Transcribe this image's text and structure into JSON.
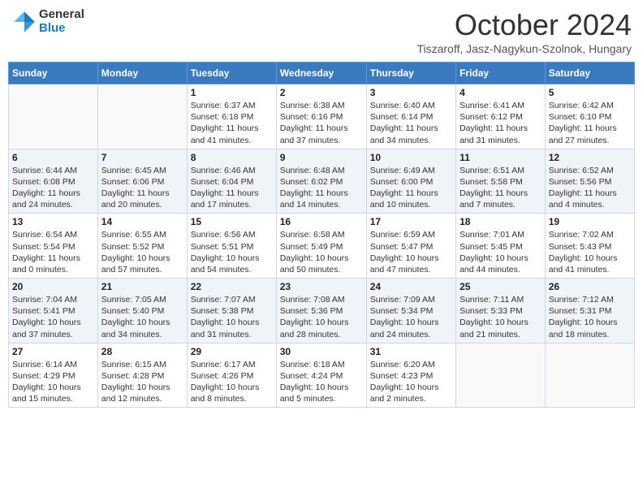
{
  "header": {
    "logo_general": "General",
    "logo_blue": "Blue",
    "month_title": "October 2024",
    "subtitle": "Tiszaroff, Jasz-Nagykun-Szolnok, Hungary"
  },
  "weekdays": [
    "Sunday",
    "Monday",
    "Tuesday",
    "Wednesday",
    "Thursday",
    "Friday",
    "Saturday"
  ],
  "weeks": [
    [
      {
        "day": "",
        "info": ""
      },
      {
        "day": "",
        "info": ""
      },
      {
        "day": "1",
        "info": "Sunrise: 6:37 AM\nSunset: 6:18 PM\nDaylight: 11 hours and 41 minutes."
      },
      {
        "day": "2",
        "info": "Sunrise: 6:38 AM\nSunset: 6:16 PM\nDaylight: 11 hours and 37 minutes."
      },
      {
        "day": "3",
        "info": "Sunrise: 6:40 AM\nSunset: 6:14 PM\nDaylight: 11 hours and 34 minutes."
      },
      {
        "day": "4",
        "info": "Sunrise: 6:41 AM\nSunset: 6:12 PM\nDaylight: 11 hours and 31 minutes."
      },
      {
        "day": "5",
        "info": "Sunrise: 6:42 AM\nSunset: 6:10 PM\nDaylight: 11 hours and 27 minutes."
      }
    ],
    [
      {
        "day": "6",
        "info": "Sunrise: 6:44 AM\nSunset: 6:08 PM\nDaylight: 11 hours and 24 minutes."
      },
      {
        "day": "7",
        "info": "Sunrise: 6:45 AM\nSunset: 6:06 PM\nDaylight: 11 hours and 20 minutes."
      },
      {
        "day": "8",
        "info": "Sunrise: 6:46 AM\nSunset: 6:04 PM\nDaylight: 11 hours and 17 minutes."
      },
      {
        "day": "9",
        "info": "Sunrise: 6:48 AM\nSunset: 6:02 PM\nDaylight: 11 hours and 14 minutes."
      },
      {
        "day": "10",
        "info": "Sunrise: 6:49 AM\nSunset: 6:00 PM\nDaylight: 11 hours and 10 minutes."
      },
      {
        "day": "11",
        "info": "Sunrise: 6:51 AM\nSunset: 5:58 PM\nDaylight: 11 hours and 7 minutes."
      },
      {
        "day": "12",
        "info": "Sunrise: 6:52 AM\nSunset: 5:56 PM\nDaylight: 11 hours and 4 minutes."
      }
    ],
    [
      {
        "day": "13",
        "info": "Sunrise: 6:54 AM\nSunset: 5:54 PM\nDaylight: 11 hours and 0 minutes."
      },
      {
        "day": "14",
        "info": "Sunrise: 6:55 AM\nSunset: 5:52 PM\nDaylight: 10 hours and 57 minutes."
      },
      {
        "day": "15",
        "info": "Sunrise: 6:56 AM\nSunset: 5:51 PM\nDaylight: 10 hours and 54 minutes."
      },
      {
        "day": "16",
        "info": "Sunrise: 6:58 AM\nSunset: 5:49 PM\nDaylight: 10 hours and 50 minutes."
      },
      {
        "day": "17",
        "info": "Sunrise: 6:59 AM\nSunset: 5:47 PM\nDaylight: 10 hours and 47 minutes."
      },
      {
        "day": "18",
        "info": "Sunrise: 7:01 AM\nSunset: 5:45 PM\nDaylight: 10 hours and 44 minutes."
      },
      {
        "day": "19",
        "info": "Sunrise: 7:02 AM\nSunset: 5:43 PM\nDaylight: 10 hours and 41 minutes."
      }
    ],
    [
      {
        "day": "20",
        "info": "Sunrise: 7:04 AM\nSunset: 5:41 PM\nDaylight: 10 hours and 37 minutes."
      },
      {
        "day": "21",
        "info": "Sunrise: 7:05 AM\nSunset: 5:40 PM\nDaylight: 10 hours and 34 minutes."
      },
      {
        "day": "22",
        "info": "Sunrise: 7:07 AM\nSunset: 5:38 PM\nDaylight: 10 hours and 31 minutes."
      },
      {
        "day": "23",
        "info": "Sunrise: 7:08 AM\nSunset: 5:36 PM\nDaylight: 10 hours and 28 minutes."
      },
      {
        "day": "24",
        "info": "Sunrise: 7:09 AM\nSunset: 5:34 PM\nDaylight: 10 hours and 24 minutes."
      },
      {
        "day": "25",
        "info": "Sunrise: 7:11 AM\nSunset: 5:33 PM\nDaylight: 10 hours and 21 minutes."
      },
      {
        "day": "26",
        "info": "Sunrise: 7:12 AM\nSunset: 5:31 PM\nDaylight: 10 hours and 18 minutes."
      }
    ],
    [
      {
        "day": "27",
        "info": "Sunrise: 6:14 AM\nSunset: 4:29 PM\nDaylight: 10 hours and 15 minutes."
      },
      {
        "day": "28",
        "info": "Sunrise: 6:15 AM\nSunset: 4:28 PM\nDaylight: 10 hours and 12 minutes."
      },
      {
        "day": "29",
        "info": "Sunrise: 6:17 AM\nSunset: 4:26 PM\nDaylight: 10 hours and 8 minutes."
      },
      {
        "day": "30",
        "info": "Sunrise: 6:18 AM\nSunset: 4:24 PM\nDaylight: 10 hours and 5 minutes."
      },
      {
        "day": "31",
        "info": "Sunrise: 6:20 AM\nSunset: 4:23 PM\nDaylight: 10 hours and 2 minutes."
      },
      {
        "day": "",
        "info": ""
      },
      {
        "day": "",
        "info": ""
      }
    ]
  ]
}
